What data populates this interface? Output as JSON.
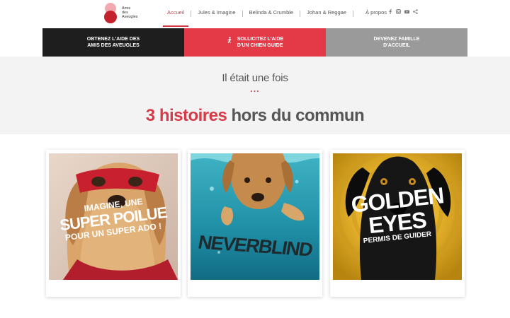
{
  "header": {
    "logo_text": [
      "Amis",
      "des",
      "Aveugles"
    ],
    "nav": [
      {
        "label": "Accueil",
        "active": true
      },
      {
        "label": "Jules & Imagine",
        "active": false
      },
      {
        "label": "Belinda & Crumble",
        "active": false
      },
      {
        "label": "Johan & Reggae",
        "active": false
      },
      {
        "label": "À propos",
        "active": false
      }
    ],
    "socials": [
      "facebook-icon",
      "instagram-icon",
      "youtube-icon",
      "share-icon"
    ]
  },
  "band": {
    "item1": {
      "line1": "OBTENEZ L'AIDE DES",
      "line2": "AMIS DES AVEUGLES"
    },
    "item2": {
      "line1": "SOLLICITEZ L'AIDE",
      "line2": "D'UN CHIEN GUIDE",
      "icon": "guide-dog-icon"
    },
    "item3": {
      "line1": "DEVENEZ FAMILLE",
      "line2": "D'ACCUEIL"
    }
  },
  "section": {
    "kicker": "Il était une fois",
    "dots": "...",
    "headline_accent": "3 histoires",
    "headline_rest": " hors du commun"
  },
  "cards": [
    {
      "name": "imagine",
      "line1": "IMAGINE, UNE",
      "line2": "SUPER POILUE",
      "line3": "POUR UN SUPER ADO !"
    },
    {
      "name": "neverblind",
      "title": "NEVERBLIND"
    },
    {
      "name": "golden-eyes",
      "line1": "GOLDEN",
      "line2": "EYES",
      "line3": "PERMIS DE GUIDER"
    }
  ],
  "colors": {
    "accent": "#d63a48",
    "band_dark": "#1e1e1e",
    "band_red": "#e43a48",
    "band_grey": "#9a9a9a"
  }
}
